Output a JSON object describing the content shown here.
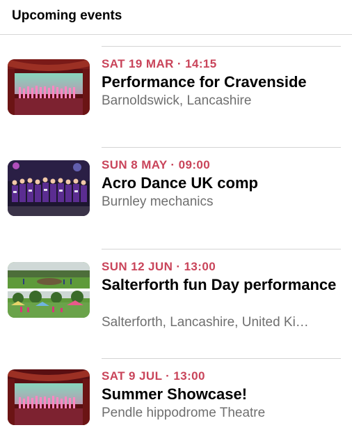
{
  "header": {
    "title": "Upcoming events"
  },
  "events": [
    {
      "date": "SAT 19 MAR · 14:15",
      "title": "Performance for Cravenside",
      "location": "Barnoldswick, Lancashire"
    },
    {
      "date": "SUN 8 MAY · 09:00",
      "title": "Acro Dance UK comp",
      "location": "Burnley mechanics"
    },
    {
      "date": "SUN 12 JUN · 13:00",
      "title": "Salterforth fun Day performance",
      "location": "Salterforth, Lancashire, United Ki…"
    },
    {
      "date": "SAT 9 JUL · 13:00",
      "title": "Summer Showcase!",
      "location": "Pendle hippodrome Theatre"
    }
  ]
}
